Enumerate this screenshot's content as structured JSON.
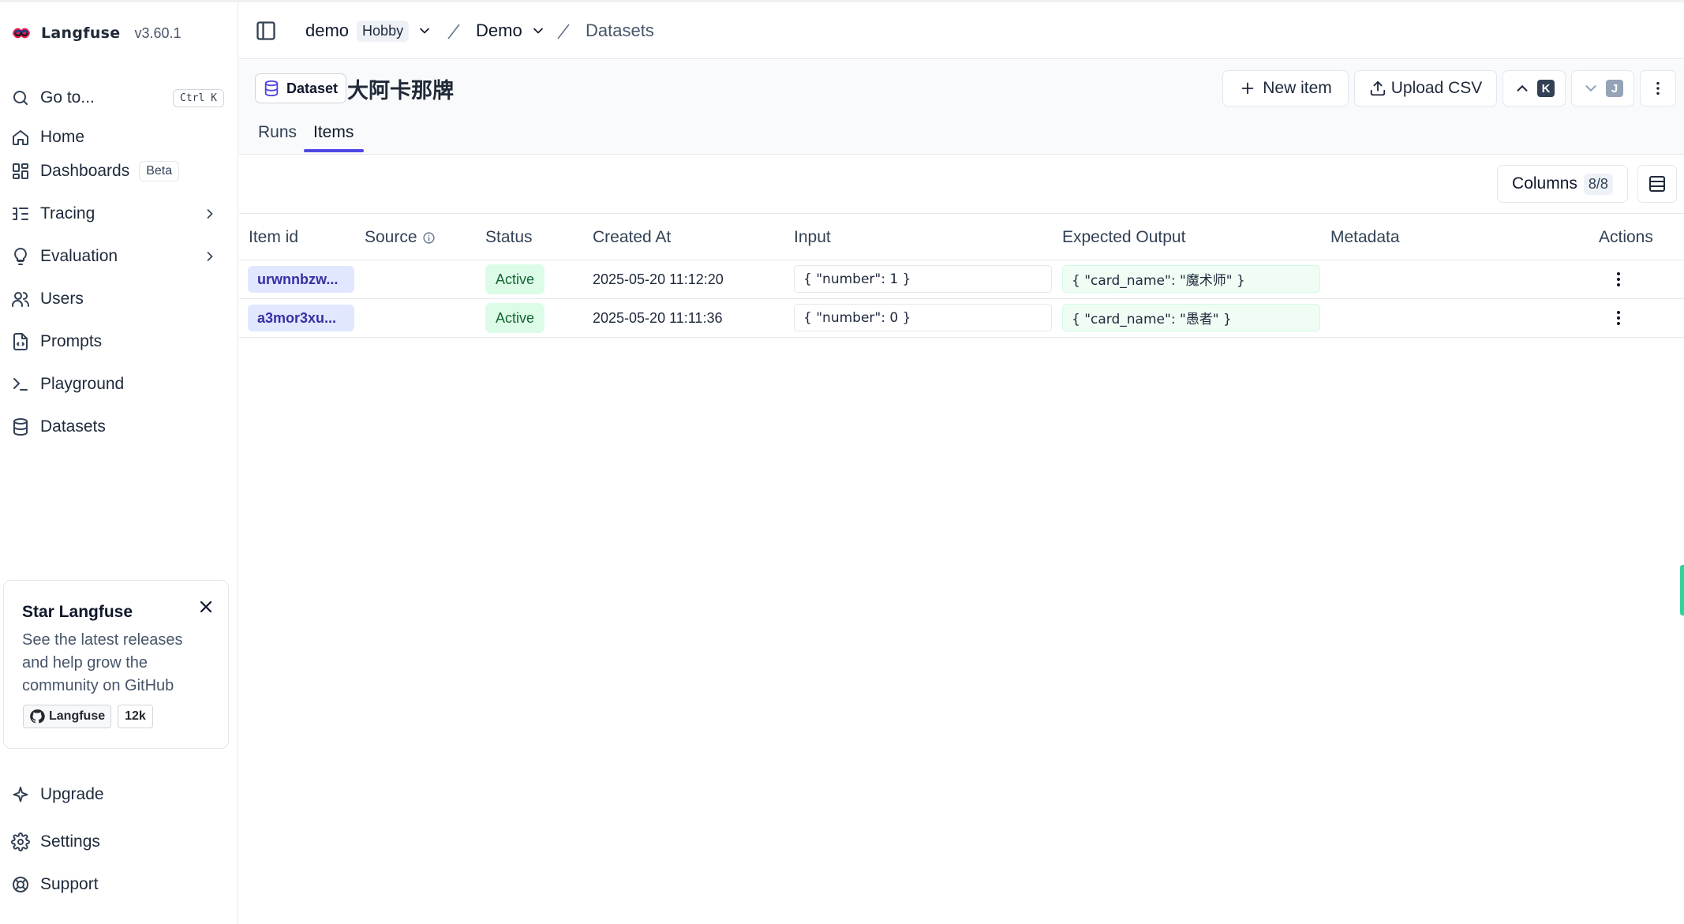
{
  "brand": {
    "name": "Langfuse",
    "version": "v3.60.1"
  },
  "sidebar": {
    "goto": {
      "label": "Go to...",
      "shortcut": "Ctrl K"
    },
    "items": [
      {
        "label": "Home",
        "icon": "home-icon"
      },
      {
        "label": "Dashboards",
        "icon": "dashboard-icon",
        "badge": "Beta"
      },
      {
        "label": "Tracing",
        "icon": "tracing-icon"
      },
      {
        "label": "Evaluation",
        "icon": "lightbulb-icon"
      },
      {
        "label": "Users",
        "icon": "users-icon"
      },
      {
        "label": "Prompts",
        "icon": "file-code-icon"
      },
      {
        "label": "Playground",
        "icon": "terminal-icon"
      },
      {
        "label": "Datasets",
        "icon": "database-icon"
      }
    ],
    "bottom": [
      {
        "label": "Upgrade",
        "icon": "sparkle-icon"
      },
      {
        "label": "Settings",
        "icon": "gear-icon"
      },
      {
        "label": "Support",
        "icon": "lifebuoy-icon"
      }
    ]
  },
  "star_card": {
    "title": "Star Langfuse",
    "text": "See the latest releases and help grow the community on GitHub",
    "github_label": "Langfuse",
    "github_count": "12k"
  },
  "header": {
    "org": "demo",
    "plan": "Hobby",
    "project": "Demo",
    "page": "Datasets"
  },
  "dataset": {
    "badge": "Dataset",
    "name": "大阿卡那牌",
    "new_item": "New item",
    "upload_csv": "Upload CSV",
    "prev_key": "K",
    "next_key": "J"
  },
  "tabs": [
    {
      "label": "Runs",
      "active": false
    },
    {
      "label": "Items",
      "active": true
    }
  ],
  "toolbar": {
    "columns_label": "Columns",
    "columns_count": "8/8"
  },
  "table": {
    "headers": [
      "Item id",
      "Source",
      "Status",
      "Created At",
      "Input",
      "Expected Output",
      "Metadata",
      "Actions"
    ],
    "rows": [
      {
        "id": "urwnnbzw...",
        "status": "Active",
        "created": "2025-05-20 11:12:20",
        "input": "{ \"number\": 1 }",
        "expected": "{ \"card_name\": \"魔术师\" }",
        "metadata": ""
      },
      {
        "id": "a3mor3xu...",
        "status": "Active",
        "created": "2025-05-20 11:11:36",
        "input": "{ \"number\": 0 }",
        "expected": "{ \"card_name\": \"愚者\" }",
        "metadata": ""
      }
    ]
  },
  "colors": {
    "accent": "#4f46e5",
    "active_bg": "#dcfce7",
    "active_fg": "#166534",
    "id_bg": "#e0e7ff"
  }
}
